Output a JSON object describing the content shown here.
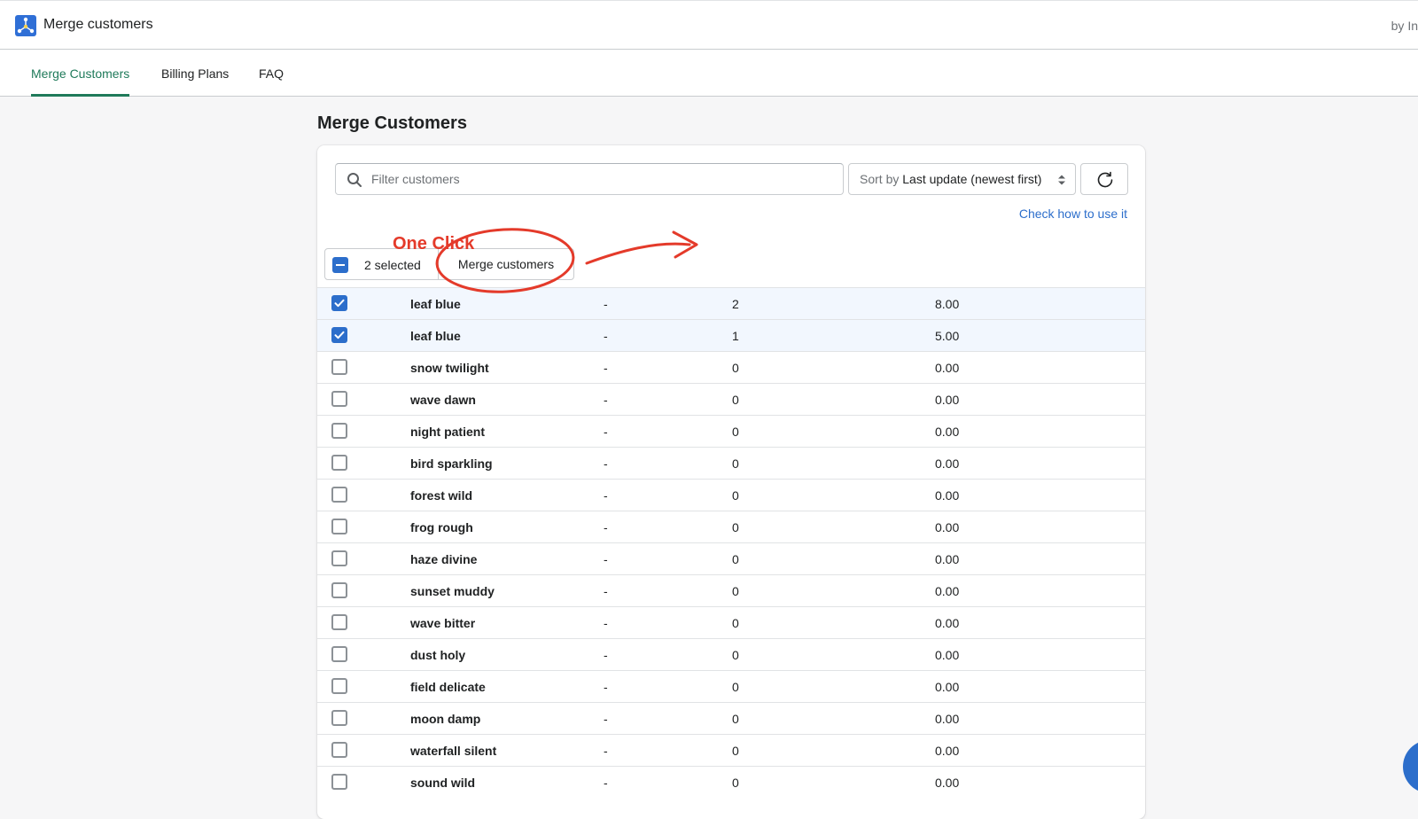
{
  "app": {
    "title": "Merge customers",
    "byline": "by In"
  },
  "tabs": [
    {
      "label": "Merge Customers",
      "active": true
    },
    {
      "label": "Billing Plans",
      "active": false
    },
    {
      "label": "FAQ",
      "active": false
    }
  ],
  "page": {
    "title": "Merge Customers"
  },
  "filter": {
    "placeholder": "Filter customers",
    "value": ""
  },
  "sort": {
    "prefix": "Sort by",
    "value": "Last update (newest first)"
  },
  "help_link": "Check how to use it",
  "bulk": {
    "selected_label": "2 selected",
    "merge_label": "Merge customers"
  },
  "annotation": {
    "text": "One Click",
    "color": "#e43a2a"
  },
  "colors": {
    "accent": "#1f7a5a",
    "primary": "#2c6ecb"
  },
  "rows": [
    {
      "name": "leaf blue",
      "dash": "-",
      "count": "2",
      "amount": "8.00",
      "checked": true
    },
    {
      "name": "leaf blue",
      "dash": "-",
      "count": "1",
      "amount": "5.00",
      "checked": true
    },
    {
      "name": "snow twilight",
      "dash": "-",
      "count": "0",
      "amount": "0.00",
      "checked": false
    },
    {
      "name": "wave dawn",
      "dash": "-",
      "count": "0",
      "amount": "0.00",
      "checked": false
    },
    {
      "name": "night patient",
      "dash": "-",
      "count": "0",
      "amount": "0.00",
      "checked": false
    },
    {
      "name": "bird sparkling",
      "dash": "-",
      "count": "0",
      "amount": "0.00",
      "checked": false
    },
    {
      "name": "forest wild",
      "dash": "-",
      "count": "0",
      "amount": "0.00",
      "checked": false
    },
    {
      "name": "frog rough",
      "dash": "-",
      "count": "0",
      "amount": "0.00",
      "checked": false
    },
    {
      "name": "haze divine",
      "dash": "-",
      "count": "0",
      "amount": "0.00",
      "checked": false
    },
    {
      "name": "sunset muddy",
      "dash": "-",
      "count": "0",
      "amount": "0.00",
      "checked": false
    },
    {
      "name": "wave bitter",
      "dash": "-",
      "count": "0",
      "amount": "0.00",
      "checked": false
    },
    {
      "name": "dust holy",
      "dash": "-",
      "count": "0",
      "amount": "0.00",
      "checked": false
    },
    {
      "name": "field delicate",
      "dash": "-",
      "count": "0",
      "amount": "0.00",
      "checked": false
    },
    {
      "name": "moon damp",
      "dash": "-",
      "count": "0",
      "amount": "0.00",
      "checked": false
    },
    {
      "name": "waterfall silent",
      "dash": "-",
      "count": "0",
      "amount": "0.00",
      "checked": false
    },
    {
      "name": "sound wild",
      "dash": "-",
      "count": "0",
      "amount": "0.00",
      "checked": false
    }
  ]
}
